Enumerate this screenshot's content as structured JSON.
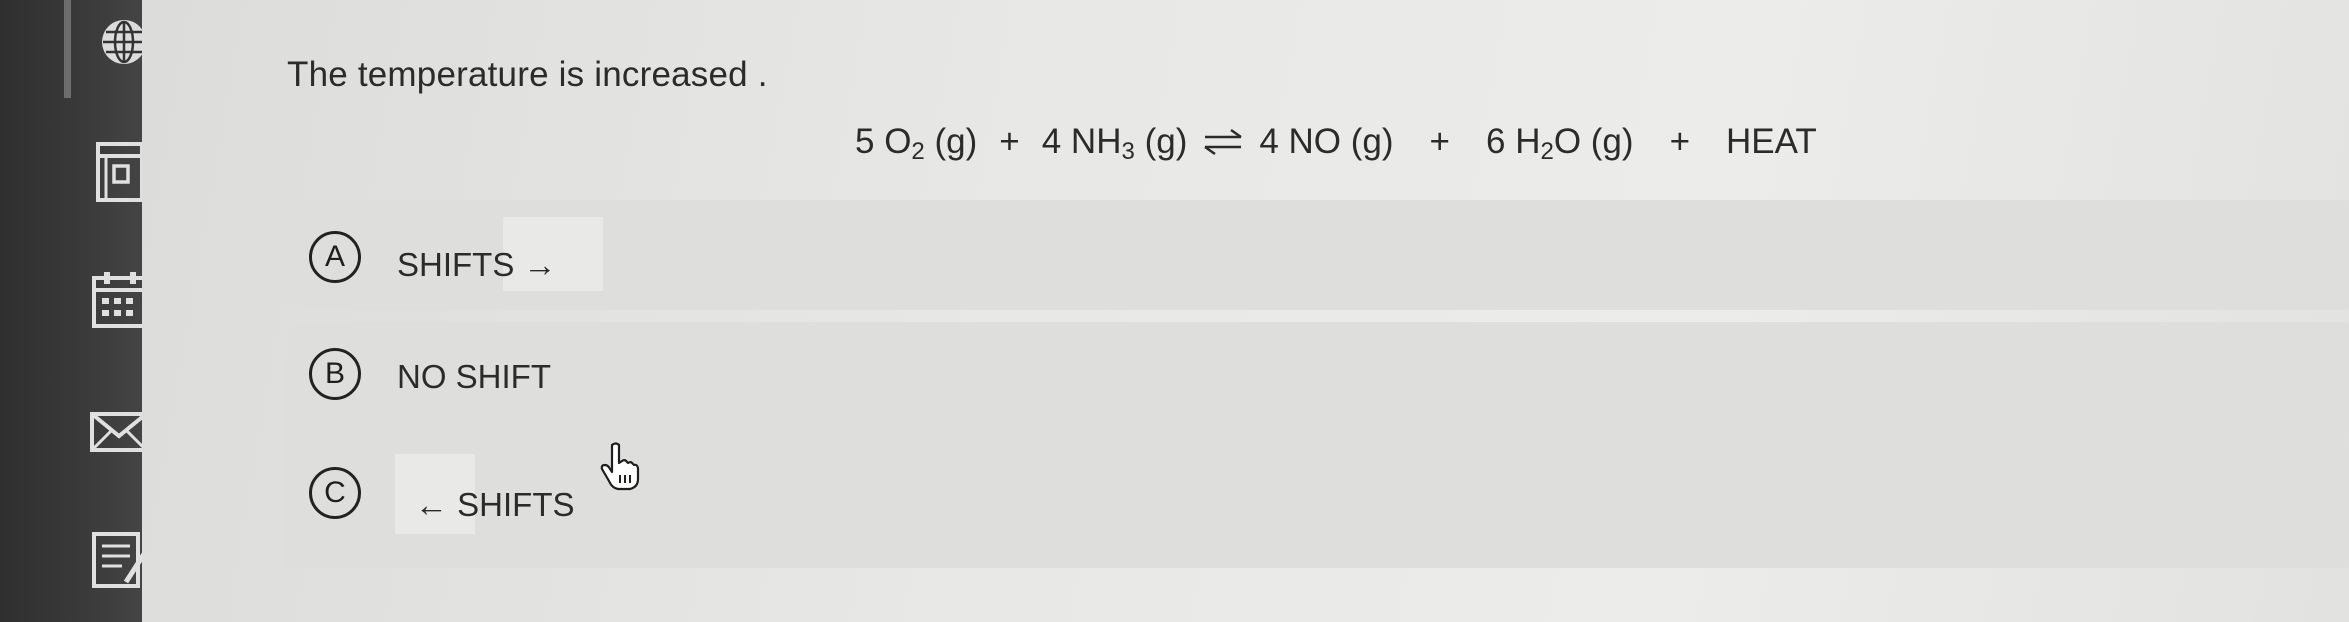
{
  "sidebar": {
    "icons": [
      "globe-icon",
      "book-icon",
      "calendar-icon",
      "mail-icon",
      "notes-icon"
    ]
  },
  "question": {
    "text": "The temperature is increased  ."
  },
  "equation": {
    "t1_coef": "5 O",
    "t1_sub": "2",
    "t1_state": " (g)",
    "plus1": "+",
    "t2_coef": "4 NH",
    "t2_sub": "3",
    "t2_state": " (g)",
    "t3": "4 NO (g)",
    "plus2": "+",
    "t4_coef": "6 H",
    "t4_sub": "2",
    "t4_rest": "O (g)",
    "plus3": "+",
    "t5": "HEAT"
  },
  "choices": [
    {
      "letter": "A",
      "text": "SHIFTS  →"
    },
    {
      "letter": "B",
      "text": "NO SHIFT"
    },
    {
      "letter": "C",
      "text": "←  SHIFTS"
    }
  ]
}
